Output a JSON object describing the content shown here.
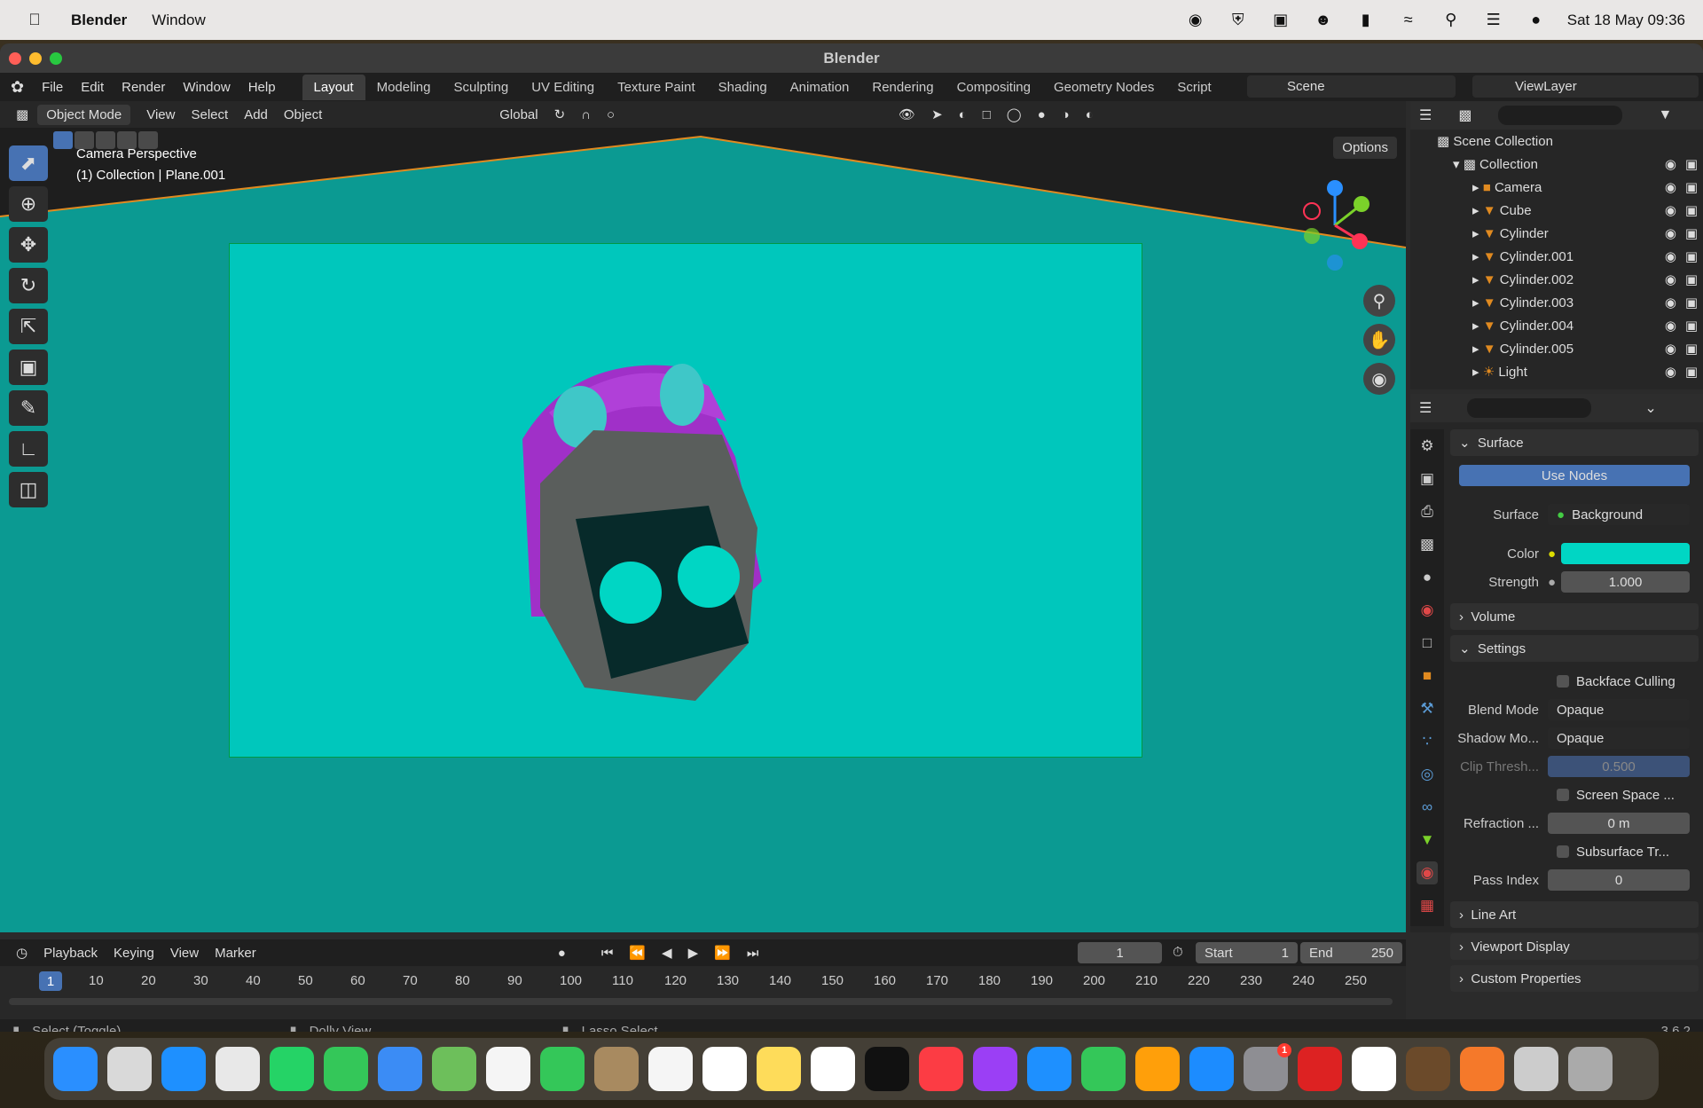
{
  "macbar": {
    "app": "Blender",
    "menu": "Window",
    "clock": "Sat 18 May  09:36"
  },
  "window": {
    "title": "Blender"
  },
  "topmenu": [
    "File",
    "Edit",
    "Render",
    "Window",
    "Help"
  ],
  "workspaces": [
    "Layout",
    "Modeling",
    "Sculpting",
    "UV Editing",
    "Texture Paint",
    "Shading",
    "Animation",
    "Rendering",
    "Compositing",
    "Geometry Nodes",
    "Script"
  ],
  "scene": "Scene",
  "viewlayer": "ViewLayer",
  "viewport": {
    "mode": "Object Mode",
    "menus": [
      "View",
      "Select",
      "Add",
      "Object"
    ],
    "orientation": "Global",
    "options": "Options",
    "overlay_line1": "Camera Perspective",
    "overlay_line2": "(1) Collection | Plane.001"
  },
  "outliner": {
    "root": "Scene Collection",
    "collection": "Collection",
    "items": [
      "Camera",
      "Cube",
      "Cylinder",
      "Cylinder.001",
      "Cylinder.002",
      "Cylinder.003",
      "Cylinder.004",
      "Cylinder.005",
      "Light"
    ]
  },
  "properties": {
    "surface_section": "Surface",
    "use_nodes": "Use Nodes",
    "surface_label": "Surface",
    "surface_value": "Background",
    "color_label": "Color",
    "color_value": "#00d6c4",
    "strength_label": "Strength",
    "strength_value": "1.000",
    "volume_section": "Volume",
    "settings_section": "Settings",
    "backface": "Backface Culling",
    "blend_label": "Blend Mode",
    "blend_value": "Opaque",
    "shadow_label": "Shadow Mo...",
    "shadow_value": "Opaque",
    "clip_label": "Clip Thresh...",
    "clip_value": "0.500",
    "screen_space": "Screen Space ...",
    "refraction_label": "Refraction ...",
    "refraction_value": "0 m",
    "subsurface": "Subsurface Tr...",
    "pass_label": "Pass Index",
    "pass_value": "0",
    "lineart": "Line Art",
    "viewport_display": "Viewport Display",
    "custom_props": "Custom Properties"
  },
  "timeline": {
    "menus": [
      "Playback",
      "Keying",
      "View",
      "Marker"
    ],
    "current": "1",
    "start_label": "Start",
    "start": "1",
    "end_label": "End",
    "end": "250",
    "ticks": [
      "10",
      "20",
      "30",
      "40",
      "50",
      "60",
      "70",
      "80",
      "90",
      "100",
      "110",
      "120",
      "130",
      "140",
      "150",
      "160",
      "170",
      "180",
      "190",
      "200",
      "210",
      "220",
      "230",
      "240",
      "250"
    ],
    "cursor": "1"
  },
  "status": {
    "select": "Select (Toggle)",
    "dolly": "Dolly View",
    "lasso": "Lasso Select",
    "version": "3.6.2"
  },
  "dock_badge": "1"
}
